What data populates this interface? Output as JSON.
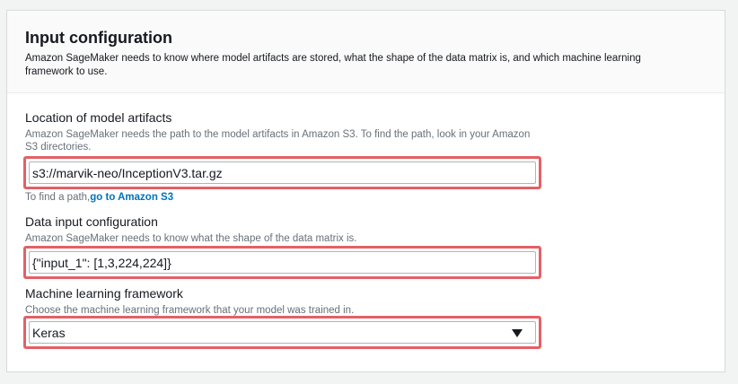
{
  "section": {
    "title": "Input configuration",
    "description": "Amazon SageMaker needs to know where model artifacts are stored, what the shape of the data matrix is, and which machine learning framework to use."
  },
  "artifacts": {
    "label": "Location of model artifacts",
    "hint": "Amazon SageMaker needs the path to the model artifacts in Amazon S3. To find the path, look in your Amazon S3 directories.",
    "value": "s3://marvik-neo/InceptionV3.tar.gz",
    "helper_prefix": "To find a path,",
    "helper_link": "go to Amazon S3"
  },
  "data_input": {
    "label": "Data input configuration",
    "hint": "Amazon SageMaker needs to know what the shape of the data matrix is.",
    "value": "{\"input_1\": [1,3,224,224]}"
  },
  "framework": {
    "label": "Machine learning framework",
    "hint": "Choose the machine learning framework that your model was trained in.",
    "selected": "Keras",
    "caret_icon": "caret-down-icon"
  },
  "colors": {
    "highlight": "#e46065",
    "link": "#0073bb"
  }
}
